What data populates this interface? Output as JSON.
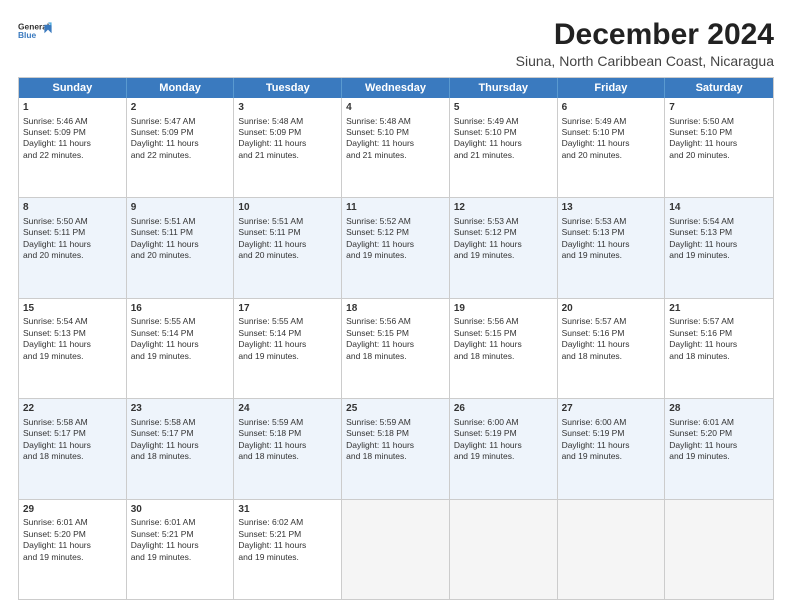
{
  "logo": {
    "line1": "General",
    "line2": "Blue"
  },
  "title": "December 2024",
  "subtitle": "Siuna, North Caribbean Coast, Nicaragua",
  "days": [
    "Sunday",
    "Monday",
    "Tuesday",
    "Wednesday",
    "Thursday",
    "Friday",
    "Saturday"
  ],
  "weeks": [
    [
      {
        "day": "1",
        "info": "Sunrise: 5:46 AM\nSunset: 5:09 PM\nDaylight: 11 hours\nand 22 minutes."
      },
      {
        "day": "2",
        "info": "Sunrise: 5:47 AM\nSunset: 5:09 PM\nDaylight: 11 hours\nand 22 minutes."
      },
      {
        "day": "3",
        "info": "Sunrise: 5:48 AM\nSunset: 5:09 PM\nDaylight: 11 hours\nand 21 minutes."
      },
      {
        "day": "4",
        "info": "Sunrise: 5:48 AM\nSunset: 5:10 PM\nDaylight: 11 hours\nand 21 minutes."
      },
      {
        "day": "5",
        "info": "Sunrise: 5:49 AM\nSunset: 5:10 PM\nDaylight: 11 hours\nand 21 minutes."
      },
      {
        "day": "6",
        "info": "Sunrise: 5:49 AM\nSunset: 5:10 PM\nDaylight: 11 hours\nand 20 minutes."
      },
      {
        "day": "7",
        "info": "Sunrise: 5:50 AM\nSunset: 5:10 PM\nDaylight: 11 hours\nand 20 minutes."
      }
    ],
    [
      {
        "day": "8",
        "info": "Sunrise: 5:50 AM\nSunset: 5:11 PM\nDaylight: 11 hours\nand 20 minutes."
      },
      {
        "day": "9",
        "info": "Sunrise: 5:51 AM\nSunset: 5:11 PM\nDaylight: 11 hours\nand 20 minutes."
      },
      {
        "day": "10",
        "info": "Sunrise: 5:51 AM\nSunset: 5:11 PM\nDaylight: 11 hours\nand 20 minutes."
      },
      {
        "day": "11",
        "info": "Sunrise: 5:52 AM\nSunset: 5:12 PM\nDaylight: 11 hours\nand 19 minutes."
      },
      {
        "day": "12",
        "info": "Sunrise: 5:53 AM\nSunset: 5:12 PM\nDaylight: 11 hours\nand 19 minutes."
      },
      {
        "day": "13",
        "info": "Sunrise: 5:53 AM\nSunset: 5:13 PM\nDaylight: 11 hours\nand 19 minutes."
      },
      {
        "day": "14",
        "info": "Sunrise: 5:54 AM\nSunset: 5:13 PM\nDaylight: 11 hours\nand 19 minutes."
      }
    ],
    [
      {
        "day": "15",
        "info": "Sunrise: 5:54 AM\nSunset: 5:13 PM\nDaylight: 11 hours\nand 19 minutes."
      },
      {
        "day": "16",
        "info": "Sunrise: 5:55 AM\nSunset: 5:14 PM\nDaylight: 11 hours\nand 19 minutes."
      },
      {
        "day": "17",
        "info": "Sunrise: 5:55 AM\nSunset: 5:14 PM\nDaylight: 11 hours\nand 19 minutes."
      },
      {
        "day": "18",
        "info": "Sunrise: 5:56 AM\nSunset: 5:15 PM\nDaylight: 11 hours\nand 18 minutes."
      },
      {
        "day": "19",
        "info": "Sunrise: 5:56 AM\nSunset: 5:15 PM\nDaylight: 11 hours\nand 18 minutes."
      },
      {
        "day": "20",
        "info": "Sunrise: 5:57 AM\nSunset: 5:16 PM\nDaylight: 11 hours\nand 18 minutes."
      },
      {
        "day": "21",
        "info": "Sunrise: 5:57 AM\nSunset: 5:16 PM\nDaylight: 11 hours\nand 18 minutes."
      }
    ],
    [
      {
        "day": "22",
        "info": "Sunrise: 5:58 AM\nSunset: 5:17 PM\nDaylight: 11 hours\nand 18 minutes."
      },
      {
        "day": "23",
        "info": "Sunrise: 5:58 AM\nSunset: 5:17 PM\nDaylight: 11 hours\nand 18 minutes."
      },
      {
        "day": "24",
        "info": "Sunrise: 5:59 AM\nSunset: 5:18 PM\nDaylight: 11 hours\nand 18 minutes."
      },
      {
        "day": "25",
        "info": "Sunrise: 5:59 AM\nSunset: 5:18 PM\nDaylight: 11 hours\nand 18 minutes."
      },
      {
        "day": "26",
        "info": "Sunrise: 6:00 AM\nSunset: 5:19 PM\nDaylight: 11 hours\nand 19 minutes."
      },
      {
        "day": "27",
        "info": "Sunrise: 6:00 AM\nSunset: 5:19 PM\nDaylight: 11 hours\nand 19 minutes."
      },
      {
        "day": "28",
        "info": "Sunrise: 6:01 AM\nSunset: 5:20 PM\nDaylight: 11 hours\nand 19 minutes."
      }
    ],
    [
      {
        "day": "29",
        "info": "Sunrise: 6:01 AM\nSunset: 5:20 PM\nDaylight: 11 hours\nand 19 minutes."
      },
      {
        "day": "30",
        "info": "Sunrise: 6:01 AM\nSunset: 5:21 PM\nDaylight: 11 hours\nand 19 minutes."
      },
      {
        "day": "31",
        "info": "Sunrise: 6:02 AM\nSunset: 5:21 PM\nDaylight: 11 hours\nand 19 minutes."
      },
      null,
      null,
      null,
      null
    ]
  ]
}
